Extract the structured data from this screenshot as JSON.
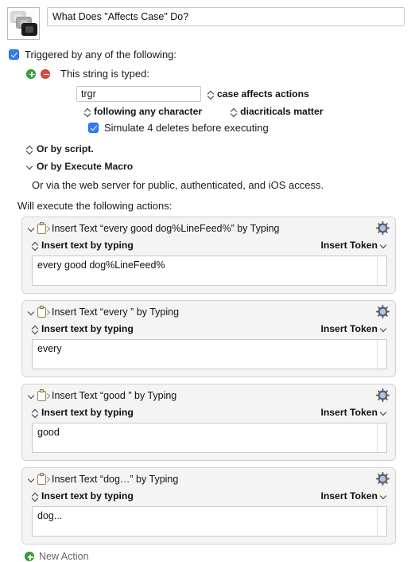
{
  "header": {
    "macro_icon": "stacked-screens-icon",
    "macro_name": "What Does \"Affects Case\" Do?"
  },
  "trigger": {
    "enabled_label": "Triggered by any of the following:",
    "add_icon": "plus-circle-icon",
    "remove_icon": "minus-circle-icon",
    "type_label": "This string is typed:",
    "string_value": "trgr",
    "case_option": "case affects actions",
    "following_option": "following any character",
    "diacriticals_option": "diacriticals matter",
    "simulate_deletes_label": "Simulate 4 deletes before executing",
    "or_by_script": "Or by script.",
    "or_by_execute_macro": "Or by Execute Macro",
    "web_server_note": "Or via the web server for public, authenticated, and iOS access."
  },
  "actions_header": "Will execute the following actions:",
  "actions": [
    {
      "title": "Insert Text “every good dog%LineFeed%” by Typing",
      "mode": "Insert text by typing",
      "insert_token": "Insert Token",
      "text": "every good dog%LineFeed%",
      "icon": "clipboard-arrow-icon",
      "gear": "gear-icon"
    },
    {
      "title": "Insert Text “every ” by Typing",
      "mode": "Insert text by typing",
      "insert_token": "Insert Token",
      "text": "every",
      "icon": "clipboard-arrow-icon",
      "gear": "gear-icon"
    },
    {
      "title": "Insert Text “good ” by Typing",
      "mode": "Insert text by typing",
      "insert_token": "Insert Token",
      "text": "good",
      "icon": "clipboard-arrow-icon",
      "gear": "gear-icon"
    },
    {
      "title": "Insert Text “dog…” by Typing",
      "mode": "Insert text by typing",
      "insert_token": "Insert Token",
      "text": "dog...",
      "icon": "clipboard-arrow-icon",
      "gear": "gear-icon"
    }
  ],
  "footer": {
    "new_action_label": "New Action",
    "new_action_icon": "plus-circle-icon"
  },
  "colors": {
    "accent_blue": "#2f7cf6",
    "add_green": "#3aa33a",
    "remove_red": "#e0493f",
    "gear_center": "#a8c4ea",
    "action_bg": "#f4f4f4",
    "field_border": "#c6c6c6"
  }
}
